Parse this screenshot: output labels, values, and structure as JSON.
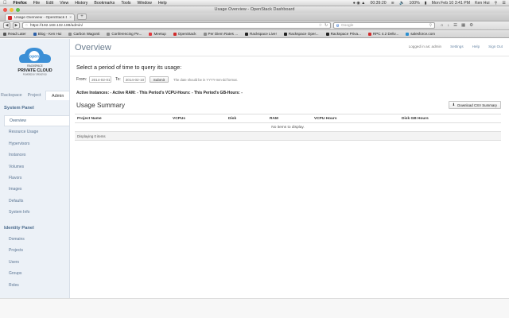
{
  "menubar": {
    "app": "Firefox",
    "items": [
      "File",
      "Edit",
      "View",
      "History",
      "Bookmarks",
      "Tools",
      "Window",
      "Help"
    ],
    "clock_timer": "00:39:20",
    "battery": "100%",
    "datetime": "Mon Feb 10  3:41 PM",
    "user": "Ken Hui"
  },
  "window": {
    "title": "Usage Overview - OpenStack Dashboard"
  },
  "browser": {
    "tab_title": "Usage Overview - OpenStack D...",
    "new_tab": "+",
    "url": "https://192.168.132.188/admin/",
    "search_placeholder": "Google",
    "bookmarks": [
      {
        "label": "Read Later",
        "color": "#555555"
      },
      {
        "label": "Blog - Ken Hui",
        "color": "#2b5fa8"
      },
      {
        "label": "Carbon Wagonti",
        "color": "#8a8a8a"
      },
      {
        "label": "Conferencing Pe...",
        "color": "#8a8a8a"
      },
      {
        "label": "Meetup",
        "color": "#e0393e"
      },
      {
        "label": "OpenStack",
        "color": "#d12a2a"
      },
      {
        "label": "Per Diem Rates ...",
        "color": "#8a8a8a"
      },
      {
        "label": "Rackspace Live!",
        "color": "#222222"
      },
      {
        "label": "Rackspace Oper...",
        "color": "#222222"
      },
      {
        "label": "Rackspace Priva...",
        "color": "#222222"
      },
      {
        "label": "RPC 4.2 Deliv...",
        "color": "#d12a2a"
      },
      {
        "label": "salesforce.com",
        "color": "#2a8fd1"
      }
    ]
  },
  "sidebar": {
    "logo_line1": "RACKSPACE",
    "logo_line2": "PRIVATE CLOUD",
    "logo_line3": "POWERED BY OPENSTACK",
    "tabs": [
      "Rackspace",
      "Project",
      "Admin"
    ],
    "system_panel": "System Panel",
    "system_items": [
      "Overview",
      "Resource Usage",
      "Hypervisors",
      "Instances",
      "Volumes",
      "Flavors",
      "Images",
      "Defaults",
      "System Info"
    ],
    "identity_panel": "Identity Panel",
    "identity_items": [
      "Domains",
      "Projects",
      "Users",
      "Groups",
      "Roles"
    ]
  },
  "header": {
    "title": "Overview",
    "logged_in": "Logged in as: admin",
    "settings": "Settings",
    "help": "Help",
    "sign_out": "Sign Out"
  },
  "query": {
    "heading": "Select a period of time to query its usage:",
    "from_label": "From:",
    "from_value": "2014-02-01",
    "to_label": "To:",
    "to_value": "2014-02-10",
    "submit": "Submit",
    "hint": "The date should be in YYYY-mm-dd format."
  },
  "stats": {
    "text": "Active Instances: - Active RAM: - This Period's VCPU-Hours: - This Period's GB-Hours: -"
  },
  "summary": {
    "heading": "Usage Summary",
    "csv_button": "Download CSV Summary",
    "columns": [
      "Project Name",
      "VCPUs",
      "Disk",
      "RAM",
      "VCPU Hours",
      "Disk GB Hours"
    ],
    "empty": "No items to display.",
    "footer": "Displaying 0 items"
  }
}
